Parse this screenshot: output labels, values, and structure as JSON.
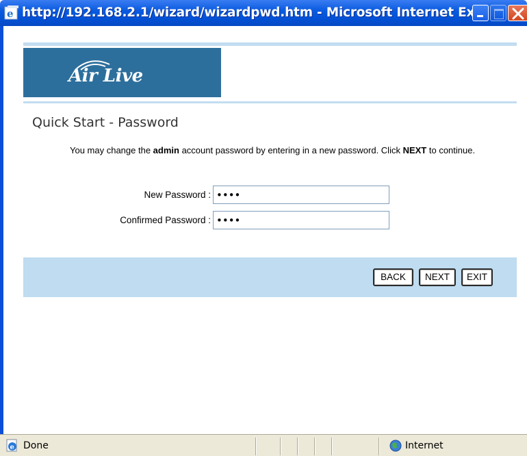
{
  "window": {
    "title": "http://192.168.2.1/wizard/wizardpwd.htm - Microsoft Internet Ex...",
    "title_color": "#0452d6"
  },
  "banner": {
    "logo_text": "Air Live",
    "bg_color": "#2d6f9c"
  },
  "page": {
    "title": "Quick Start - Password",
    "desc_part1": "You may change the ",
    "desc_bold1": "admin",
    "desc_part2": " account password by entering in a new password. Click ",
    "desc_bold2": "NEXT",
    "desc_part3": " to continue."
  },
  "form": {
    "new_password_label": "New Password :",
    "new_password_value": "1234",
    "confirm_password_label": "Confirmed Password :",
    "confirm_password_value": "1234"
  },
  "buttons": {
    "back": "BACK",
    "next": "NEXT",
    "exit": "EXIT"
  },
  "statusbar": {
    "status": "Done",
    "zone": "Internet"
  }
}
